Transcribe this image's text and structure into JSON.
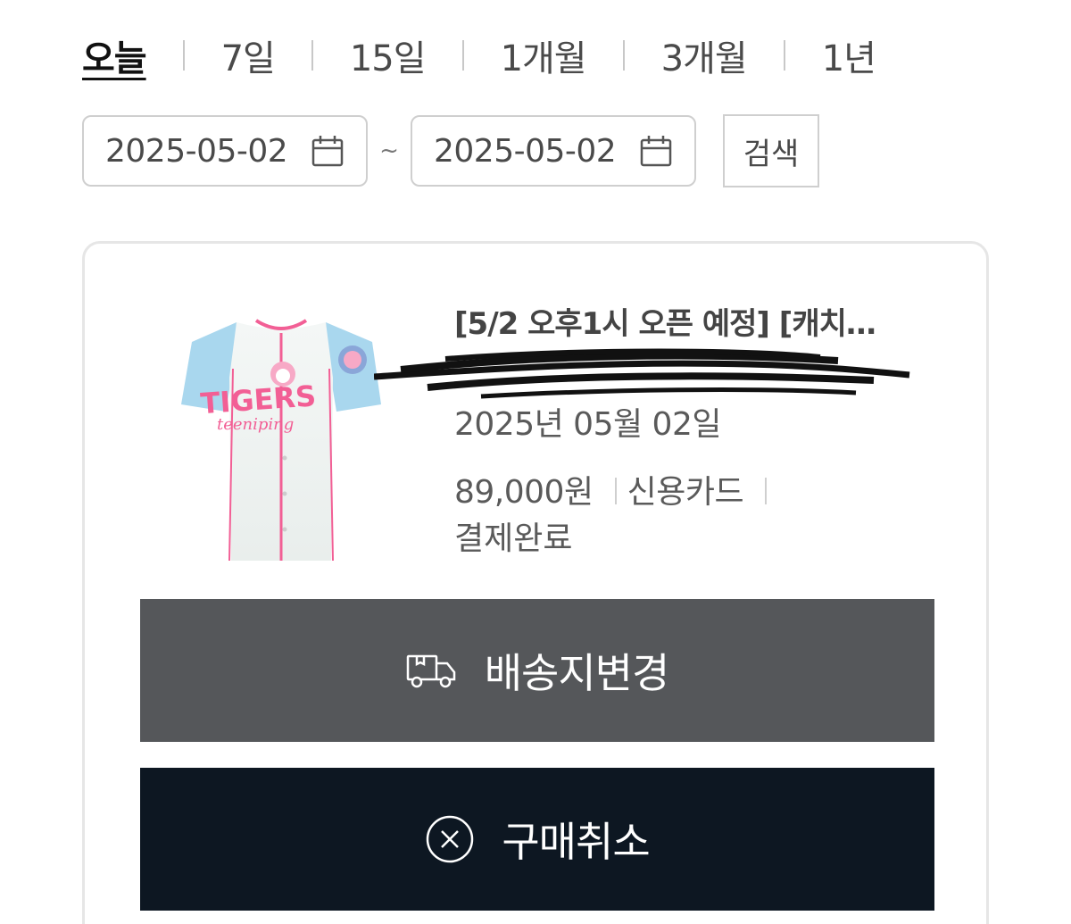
{
  "period_tabs": [
    {
      "label": "오늘",
      "active": true
    },
    {
      "label": "7일",
      "active": false
    },
    {
      "label": "15일",
      "active": false
    },
    {
      "label": "1개월",
      "active": false
    },
    {
      "label": "3개월",
      "active": false
    },
    {
      "label": "1년",
      "active": false
    }
  ],
  "date_range": {
    "start": "2025-05-02",
    "separator": "~",
    "end": "2025-05-02",
    "search_label": "검색"
  },
  "order": {
    "product_title": "[5/2 오후1시 오픈 예정] [캐치…",
    "product_image": "tigers-jersey",
    "order_date": "2025년 05월 02일",
    "price": "89,000원",
    "payment_method": "신용카드",
    "status": "결제완료",
    "change_address_label": "배송지변경",
    "cancel_label": "구매취소",
    "icons": {
      "change_address": "delivery-truck-icon",
      "cancel": "close-circle-icon"
    }
  },
  "colors": {
    "change_button_bg": "#55575a",
    "cancel_button_bg": "#0d1722"
  }
}
